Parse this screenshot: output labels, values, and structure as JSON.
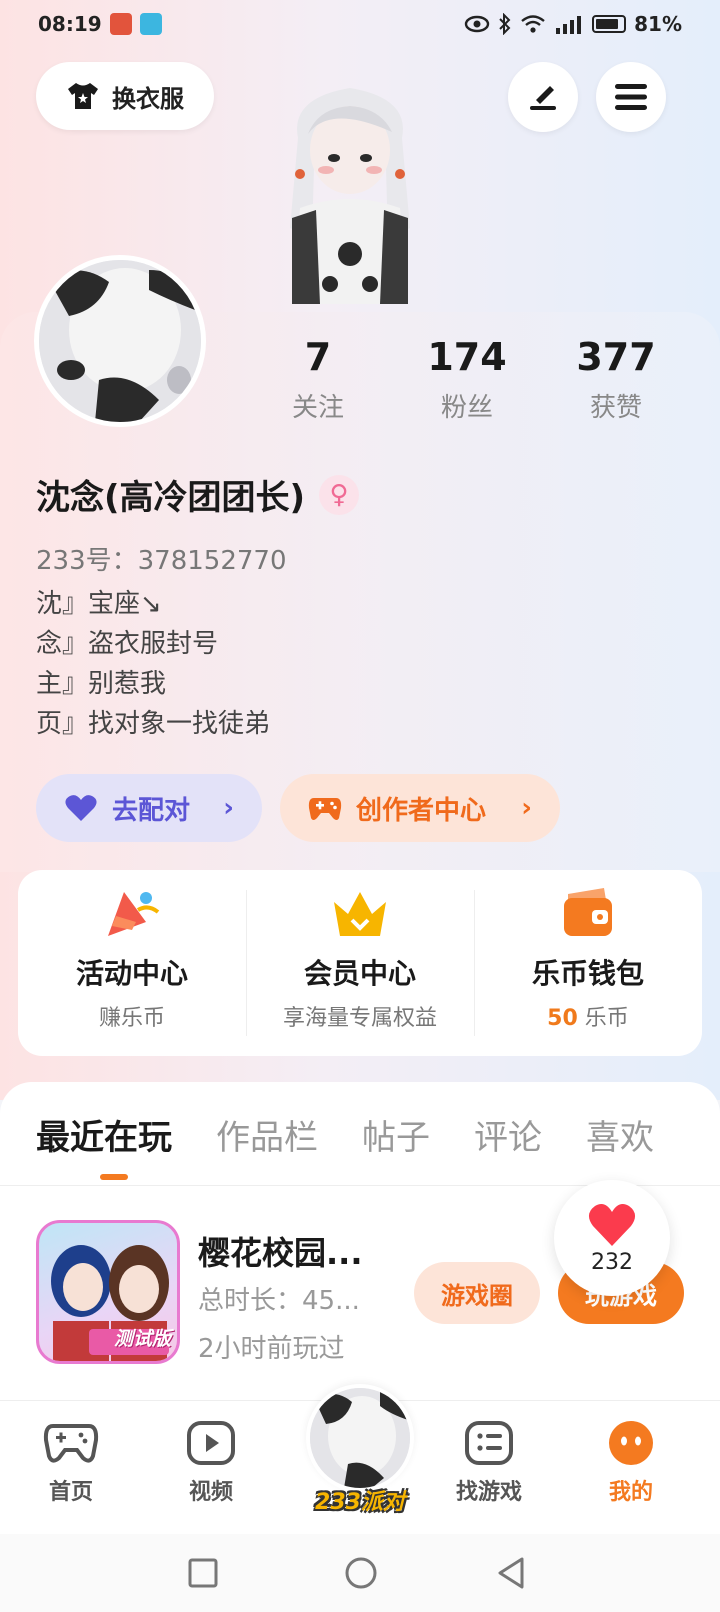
{
  "status_bar": {
    "time": "08:19",
    "battery": "81%"
  },
  "header": {
    "outfit_label": "换衣服"
  },
  "stats": [
    {
      "value": "7",
      "label": "关注"
    },
    {
      "value": "174",
      "label": "粉丝"
    },
    {
      "value": "377",
      "label": "获赞"
    }
  ],
  "profile": {
    "name": "沈念(高冷团团长)",
    "uid": "233号：378152770",
    "bio": [
      "沈』宝座↘",
      "念』盗衣服封号",
      "主』别惹我",
      "页』找对象一找徒弟"
    ]
  },
  "actions": {
    "match": "去配对",
    "creator": "创作者中心"
  },
  "services": [
    {
      "title": "活动中心",
      "sub": "赚乐币"
    },
    {
      "title": "会员中心",
      "sub": "享海量专属权益"
    },
    {
      "title": "乐币钱包",
      "sub_value": "50",
      "sub_unit": "乐币"
    }
  ],
  "tabs": [
    "最近在玩",
    "作品栏",
    "帖子",
    "评论",
    "喜欢"
  ],
  "recent_game": {
    "title": "樱花校园...",
    "duration": "总时长：45...",
    "last_played": "2小时前玩过",
    "badge": "测试版",
    "circle_button": "游戏圈",
    "play_button": "玩游戏"
  },
  "like_count": "232",
  "bottom_nav": {
    "home": "首页",
    "video": "视频",
    "party": "233派对",
    "find_games": "找游戏",
    "mine": "我的"
  },
  "colors": {
    "accent": "#f47a20",
    "match": "#5c56d6",
    "creator_bg": "#fde4d8"
  }
}
